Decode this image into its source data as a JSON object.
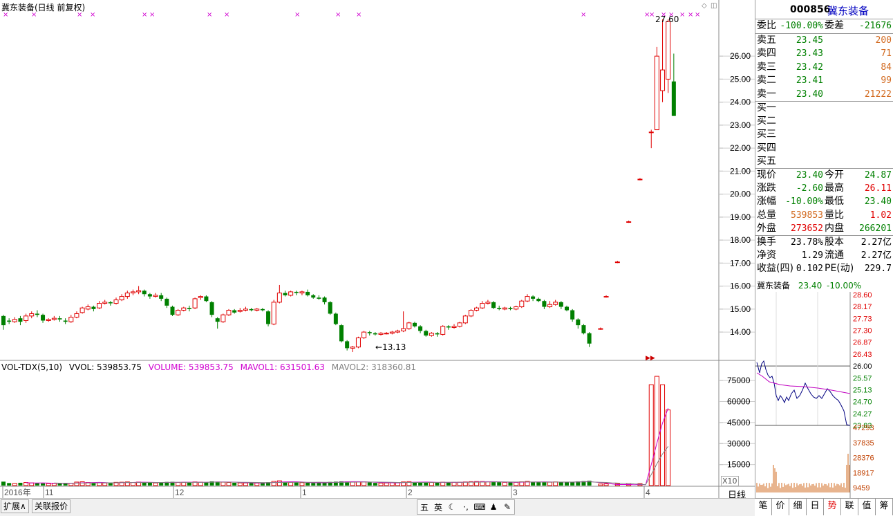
{
  "main": {
    "title": "冀东装备(日线 前复权)",
    "high_label": "27.60",
    "low_label": "13.13",
    "price_axis": [
      "26.00",
      "25.00",
      "24.00",
      "23.00",
      "22.00",
      "21.00",
      "20.00",
      "19.00",
      "18.00",
      "17.00",
      "16.00",
      "15.00",
      "14.00"
    ],
    "vol_header": {
      "name": "VOL-TDX(5,10)",
      "vvol": "VVOL: 539853.75",
      "volume": "VOLUME: 539853.75",
      "mavol1": "MAVOL1: 631501.63",
      "mavol2": "MAVOL2: 318360.81"
    },
    "vol_axis": [
      "75000",
      "60000",
      "45000",
      "30000",
      "15000"
    ],
    "vol_unit": "X10",
    "date_axis": [
      {
        "label": "2016年",
        "x": 4
      },
      {
        "label": "11",
        "x": 63
      },
      {
        "label": "12",
        "x": 251
      },
      {
        "label": "1",
        "x": 435
      },
      {
        "label": "2",
        "x": 588
      },
      {
        "label": "3",
        "x": 740
      },
      {
        "label": "4",
        "x": 932
      }
    ],
    "period_label": "日线",
    "colors": {
      "up": "#e00000",
      "down": "#008000",
      "ma1": "#d000d0",
      "ma2": "#808080",
      "marker": "#d000d0"
    }
  },
  "chart_data": {
    "type": "candlestick",
    "title": "冀东装备(日线 前复权)",
    "ylim": [
      12.8,
      27.9
    ],
    "candles": [
      [
        14.7,
        14.3,
        14.75,
        14.1
      ],
      [
        14.5,
        14.45,
        14.6,
        14.35
      ],
      [
        14.45,
        14.55,
        14.65,
        14.4
      ],
      [
        14.6,
        14.45,
        14.7,
        14.3
      ],
      [
        14.5,
        14.7,
        14.8,
        14.4
      ],
      [
        14.7,
        14.8,
        14.9,
        14.6
      ],
      [
        14.8,
        14.75,
        14.95,
        14.65
      ],
      [
        14.75,
        14.5,
        14.8,
        14.4
      ],
      [
        14.5,
        14.55,
        14.6,
        14.45
      ],
      [
        14.55,
        14.6,
        14.7,
        14.5
      ],
      [
        14.6,
        14.55,
        14.7,
        14.45
      ],
      [
        14.5,
        14.45,
        14.6,
        14.35
      ],
      [
        14.45,
        14.65,
        14.75,
        14.4
      ],
      [
        14.65,
        14.8,
        14.9,
        14.6
      ],
      [
        14.85,
        15.05,
        15.1,
        14.8
      ],
      [
        15.0,
        15.1,
        15.2,
        14.95
      ],
      [
        15.1,
        15.0,
        15.15,
        14.9
      ],
      [
        15.05,
        15.25,
        15.35,
        15.0
      ],
      [
        15.25,
        15.3,
        15.4,
        15.2
      ],
      [
        15.3,
        15.25,
        15.35,
        15.15
      ],
      [
        15.25,
        15.4,
        15.5,
        15.2
      ],
      [
        15.4,
        15.55,
        15.65,
        15.35
      ],
      [
        15.55,
        15.7,
        15.8,
        15.45
      ],
      [
        15.7,
        15.75,
        15.85,
        15.6
      ],
      [
        15.75,
        15.8,
        16.0,
        15.65
      ],
      [
        15.8,
        15.65,
        15.85,
        15.55
      ],
      [
        15.65,
        15.55,
        15.7,
        15.45
      ],
      [
        15.55,
        15.6,
        15.7,
        15.5
      ],
      [
        15.6,
        15.45,
        15.7,
        15.35
      ],
      [
        15.45,
        15.15,
        15.5,
        15.05
      ],
      [
        15.1,
        14.75,
        15.15,
        14.7
      ],
      [
        14.75,
        14.95,
        15.0,
        14.7
      ],
      [
        14.95,
        15.05,
        15.1,
        14.9
      ],
      [
        15.05,
        15.0,
        15.15,
        14.9
      ],
      [
        15.05,
        15.45,
        15.5,
        15.0
      ],
      [
        15.5,
        15.55,
        15.6,
        15.4
      ],
      [
        15.55,
        15.35,
        15.6,
        15.3
      ],
      [
        15.3,
        14.75,
        15.35,
        14.65
      ],
      [
        14.6,
        14.45,
        14.65,
        14.15
      ],
      [
        14.45,
        14.75,
        14.8,
        14.4
      ],
      [
        14.75,
        14.95,
        15.0,
        14.7
      ],
      [
        14.95,
        14.85,
        15.0,
        14.8
      ],
      [
        14.9,
        14.95,
        15.05,
        14.85
      ],
      [
        14.95,
        15.0,
        15.1,
        14.9
      ],
      [
        15.0,
        14.95,
        15.05,
        14.9
      ],
      [
        14.95,
        15.0,
        15.05,
        14.9
      ],
      [
        15.0,
        14.95,
        15.05,
        14.9
      ],
      [
        14.9,
        14.35,
        14.95,
        14.25
      ],
      [
        14.35,
        15.3,
        15.4,
        14.3
      ],
      [
        15.3,
        15.7,
        16.05,
        15.25
      ],
      [
        15.7,
        15.6,
        15.8,
        15.55
      ],
      [
        15.6,
        15.75,
        15.8,
        15.55
      ],
      [
        15.75,
        15.7,
        15.8,
        15.6
      ],
      [
        15.7,
        15.75,
        15.8,
        15.6
      ],
      [
        15.75,
        15.6,
        15.85,
        15.55
      ],
      [
        15.6,
        15.5,
        15.65,
        15.45
      ],
      [
        15.5,
        15.45,
        15.6,
        15.4
      ],
      [
        15.5,
        15.3,
        15.55,
        15.2
      ],
      [
        15.3,
        14.8,
        15.35,
        14.75
      ],
      [
        14.8,
        14.35,
        14.85,
        14.3
      ],
      [
        14.3,
        13.6,
        14.35,
        13.55
      ],
      [
        13.6,
        13.3,
        13.65,
        13.2
      ],
      [
        13.3,
        13.35,
        13.4,
        13.13
      ],
      [
        13.35,
        13.75,
        13.8,
        13.3
      ],
      [
        13.75,
        14.0,
        14.05,
        13.7
      ],
      [
        14.0,
        13.95,
        14.05,
        13.85
      ],
      [
        13.95,
        13.9,
        14.0,
        13.85
      ],
      [
        13.9,
        13.95,
        14.0,
        13.85
      ],
      [
        13.95,
        13.95,
        14.0,
        13.9
      ],
      [
        13.95,
        14.0,
        14.05,
        13.9
      ],
      [
        14.0,
        14.05,
        14.1,
        13.95
      ],
      [
        14.05,
        14.15,
        14.9,
        14.0
      ],
      [
        14.15,
        14.4,
        14.45,
        14.1
      ],
      [
        14.4,
        14.25,
        14.45,
        14.2
      ],
      [
        14.25,
        14.05,
        14.3,
        13.95
      ],
      [
        14.05,
        13.85,
        14.1,
        13.8
      ],
      [
        13.85,
        13.95,
        14.0,
        13.8
      ],
      [
        13.95,
        13.9,
        14.0,
        13.8
      ],
      [
        13.9,
        14.25,
        14.3,
        13.85
      ],
      [
        14.25,
        14.2,
        14.3,
        14.1
      ],
      [
        14.2,
        14.25,
        14.35,
        14.15
      ],
      [
        14.25,
        14.4,
        14.45,
        14.2
      ],
      [
        14.4,
        14.7,
        14.75,
        14.35
      ],
      [
        14.7,
        14.95,
        15.0,
        14.65
      ],
      [
        14.95,
        15.05,
        15.1,
        14.9
      ],
      [
        15.05,
        15.25,
        15.35,
        15.0
      ],
      [
        15.25,
        15.3,
        15.4,
        15.2
      ],
      [
        15.3,
        15.05,
        15.35,
        15.0
      ],
      [
        15.05,
        15.0,
        15.15,
        14.95
      ],
      [
        15.0,
        15.05,
        15.1,
        14.95
      ],
      [
        15.05,
        15.0,
        15.1,
        14.95
      ],
      [
        15.0,
        15.1,
        15.15,
        14.95
      ],
      [
        15.1,
        15.35,
        15.4,
        15.05
      ],
      [
        15.35,
        15.55,
        15.65,
        15.3
      ],
      [
        15.55,
        15.45,
        15.6,
        15.35
      ],
      [
        15.45,
        15.35,
        15.5,
        15.3
      ],
      [
        15.35,
        15.1,
        15.4,
        15.0
      ],
      [
        15.1,
        15.2,
        15.35,
        15.05
      ],
      [
        15.2,
        15.3,
        15.4,
        15.15
      ],
      [
        15.3,
        15.1,
        15.35,
        15.0
      ],
      [
        15.1,
        14.95,
        15.15,
        14.9
      ],
      [
        14.95,
        14.55,
        15.0,
        14.45
      ],
      [
        14.55,
        14.3,
        14.6,
        14.15
      ],
      [
        14.3,
        13.95,
        14.35,
        13.9
      ],
      [
        13.95,
        13.5,
        14.0,
        13.35
      ],
      [
        null,
        null,
        null,
        null
      ],
      [
        14.15,
        14.15,
        14.2,
        14.1
      ],
      [
        15.55,
        15.55,
        15.6,
        15.5
      ],
      [
        null,
        null,
        null,
        null
      ],
      [
        17.05,
        17.05,
        17.1,
        17.0
      ],
      [
        null,
        null,
        null,
        null
      ],
      [
        18.8,
        18.8,
        18.85,
        18.75
      ],
      [
        null,
        null,
        null,
        null
      ],
      [
        20.65,
        20.65,
        20.7,
        20.6
      ],
      [
        null,
        null,
        null,
        null
      ],
      [
        22.7,
        22.7,
        22.8,
        22.0
      ],
      [
        22.8,
        26.0,
        26.4,
        22.8
      ],
      [
        24.5,
        25.4,
        27.6,
        24.0
      ],
      [
        25.0,
        27.5,
        27.6,
        24.4
      ],
      [
        24.9,
        23.4,
        26.11,
        23.4
      ]
    ],
    "volume": {
      "ylim": [
        0,
        80000
      ],
      "values": [
        2800,
        1800,
        1500,
        2000,
        2200,
        1900,
        1800,
        1600,
        1400,
        1500,
        1700,
        1500,
        1600,
        2500,
        2700,
        2200,
        1800,
        2100,
        1900,
        1700,
        2300,
        2400,
        2600,
        2200,
        2500,
        2400,
        2000,
        1900,
        2100,
        2600,
        2700,
        2200,
        2300,
        2100,
        2600,
        2400,
        2300,
        3000,
        2800,
        2400,
        2200,
        2000,
        1900,
        1900,
        2000,
        1800,
        1800,
        2400,
        3000,
        3400,
        2600,
        2300,
        2200,
        2100,
        2000,
        1900,
        2000,
        2200,
        2600,
        2800,
        3000,
        2900,
        2600,
        2500,
        2600,
        2200,
        1900,
        1800,
        1900,
        2000,
        2100,
        2600,
        2800,
        2500,
        2400,
        2300,
        2200,
        2100,
        2400,
        2300,
        2300,
        2400,
        2600,
        2800,
        2900,
        2900,
        2700,
        2500,
        2400,
        2300,
        2200,
        2300,
        2700,
        3000,
        2600,
        2400,
        2500,
        2400,
        2600,
        2500,
        2400,
        2500,
        3000,
        3200,
        3500,
        0,
        1100,
        1200,
        0,
        1300,
        0,
        1400,
        0,
        1400,
        0,
        72000,
        78000,
        72000,
        54000
      ],
      "mavol1_label": "MAVOL1",
      "mavol2_label": "MAVOL2"
    },
    "xlabel": "",
    "ylabel": ""
  },
  "quote": {
    "code": "000856",
    "name": "冀东装备",
    "weibi_label": "委比",
    "weibi": "-100.00%",
    "weicha_label": "委差",
    "weicha": "-21676",
    "sells": [
      {
        "label": "卖五",
        "price": "23.45",
        "vol": "200"
      },
      {
        "label": "卖四",
        "price": "23.43",
        "vol": "71"
      },
      {
        "label": "卖三",
        "price": "23.42",
        "vol": "84"
      },
      {
        "label": "卖二",
        "price": "23.41",
        "vol": "99"
      },
      {
        "label": "卖一",
        "price": "23.40",
        "vol": "21222"
      }
    ],
    "buys": [
      {
        "label": "买一"
      },
      {
        "label": "买二"
      },
      {
        "label": "买三"
      },
      {
        "label": "买四"
      },
      {
        "label": "买五"
      }
    ],
    "stats": [
      {
        "l1": "现价",
        "v1": "23.40",
        "c1": "green",
        "l2": "今开",
        "v2": "24.87",
        "c2": "green"
      },
      {
        "l1": "涨跌",
        "v1": "-2.60",
        "c1": "green",
        "l2": "最高",
        "v2": "26.11",
        "c2": "red"
      },
      {
        "l1": "涨幅",
        "v1": "-10.00%",
        "c1": "green",
        "l2": "最低",
        "v2": "23.40",
        "c2": "green"
      },
      {
        "l1": "总量",
        "v1": "539853",
        "c1": "orange",
        "l2": "量比",
        "v2": "1.02",
        "c2": "red"
      },
      {
        "l1": "外盘",
        "v1": "273652",
        "c1": "red",
        "l2": "内盘",
        "v2": "266201",
        "c2": "green"
      }
    ],
    "stats2": [
      {
        "l1": "换手",
        "v1": "23.78%",
        "l2": "股本",
        "v2": "2.27亿"
      },
      {
        "l1": "净资",
        "v1": "1.29",
        "l2": "流通",
        "v2": "2.27亿"
      },
      {
        "l1": "收益(四)",
        "v1": "0.102",
        "l2": "PE(动)",
        "v2": "229.7"
      }
    ]
  },
  "mini": {
    "name": "冀东装备",
    "price": "23.40",
    "change": "-10.00%",
    "price_axis": [
      "28.60",
      "28.17",
      "27.73",
      "27.30",
      "26.87",
      "26.43",
      "26.00",
      "25.57",
      "25.13",
      "24.70",
      "24.27",
      "23.83"
    ],
    "vol_axis": [
      "47293",
      "37835",
      "28376",
      "18917",
      "9459"
    ]
  },
  "tabs": [
    "笔",
    "价",
    "细",
    "日",
    "势",
    "联",
    "值",
    "筹"
  ],
  "statusbar": {
    "expand": "扩展∧",
    "related": "关联报价"
  },
  "ime": [
    "五",
    "英",
    "☾",
    "·,",
    "⌨",
    "♟",
    "✎"
  ]
}
